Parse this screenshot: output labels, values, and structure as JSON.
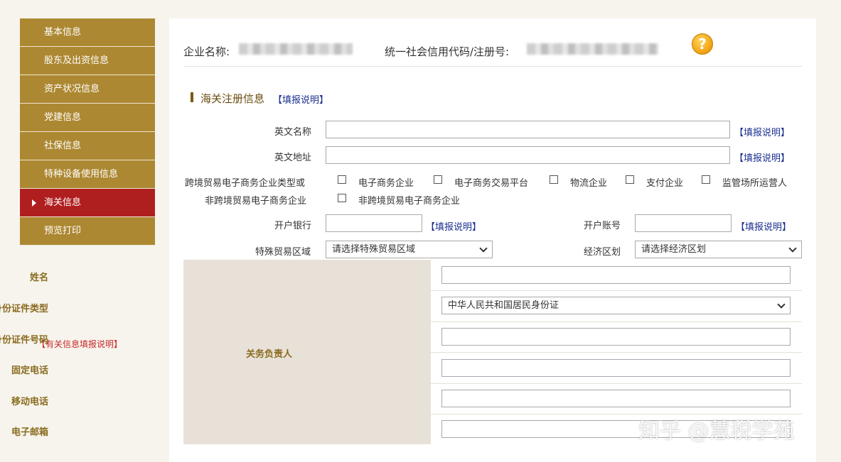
{
  "sidebar": {
    "items": [
      {
        "label": "基本信息"
      },
      {
        "label": "股东及出资信息"
      },
      {
        "label": "资产状况信息"
      },
      {
        "label": "党建信息"
      },
      {
        "label": "社保信息"
      },
      {
        "label": "特种设备使用信息"
      },
      {
        "label": "海关信息",
        "active": true
      },
      {
        "label": "预览打印"
      }
    ],
    "help_link": "【有关信息填报说明】"
  },
  "header": {
    "company_label": "企业名称:",
    "credit_code_label": "统一社会信用代码/注册号:",
    "help_icon": "?"
  },
  "section": {
    "title": "海关注册信息",
    "help_link": "【填报说明】"
  },
  "form": {
    "english_name_label": "英文名称",
    "english_address_label": "英文地址",
    "help_link": "【填报说明】",
    "ecommerce_type_label": "跨境贸易电子商务企业类型或",
    "non_ecommerce_label": "非跨境贸易电子商务企业",
    "options": [
      "电子商务企业",
      "电子商务交易平台",
      "物流企业",
      "支付企业",
      "监管场所运营人"
    ],
    "non_option": "非跨境贸易电子商务企业",
    "bank_label": "开户银行",
    "account_label": "开户账号",
    "special_zone_label": "特殊贸易区域",
    "special_zone_value": "请选择特殊贸易区域",
    "economic_zone_label": "经济区划",
    "economic_zone_value": "请选择经济区划"
  },
  "responsible": {
    "group_label": "关务负责人",
    "name_label": "姓名",
    "id_type_label": "身份证件类型",
    "id_type_value": "中华人民共和国居民身份证",
    "id_number_label": "身份证件号码",
    "phone_label": "固定电话",
    "mobile_label": "移动电话",
    "email_label": "电子邮箱"
  },
  "watermark": "知乎 @慧税学苑",
  "colors": {
    "nav": "#ad8832",
    "nav_active": "#b01f1f",
    "link": "#1a2f8f",
    "label_brown": "#8a6b1e"
  }
}
